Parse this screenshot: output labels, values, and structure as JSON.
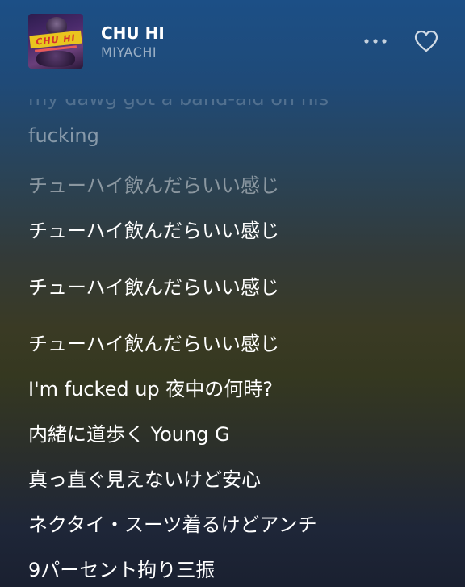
{
  "track": {
    "title": "CHU HI",
    "artist": "MIYACHI",
    "album_art_text": "CHU HI"
  },
  "controls": {
    "more_icon": "more-horizontal-icon",
    "like_icon": "heart-outline-icon"
  },
  "lyrics": {
    "lines": [
      "my dawg got a band-aid on his",
      "fucking",
      "チューハイ飲んだらいい感じ",
      "チューハイ飲んだらいい感じ",
      "チューハイ飲んだらいい感じ",
      "チューハイ飲んだらいい感じ",
      "I'm fucked up 夜中の何時?",
      "内緒に道歩く Young G",
      "真っ直ぐ見えないけど安心",
      "ネクタイ・スーツ着るけどアンチ",
      "9パーセント拘り三振"
    ]
  },
  "colors": {
    "text_primary": "#ffffff",
    "text_secondary": "#a9b2bd"
  }
}
